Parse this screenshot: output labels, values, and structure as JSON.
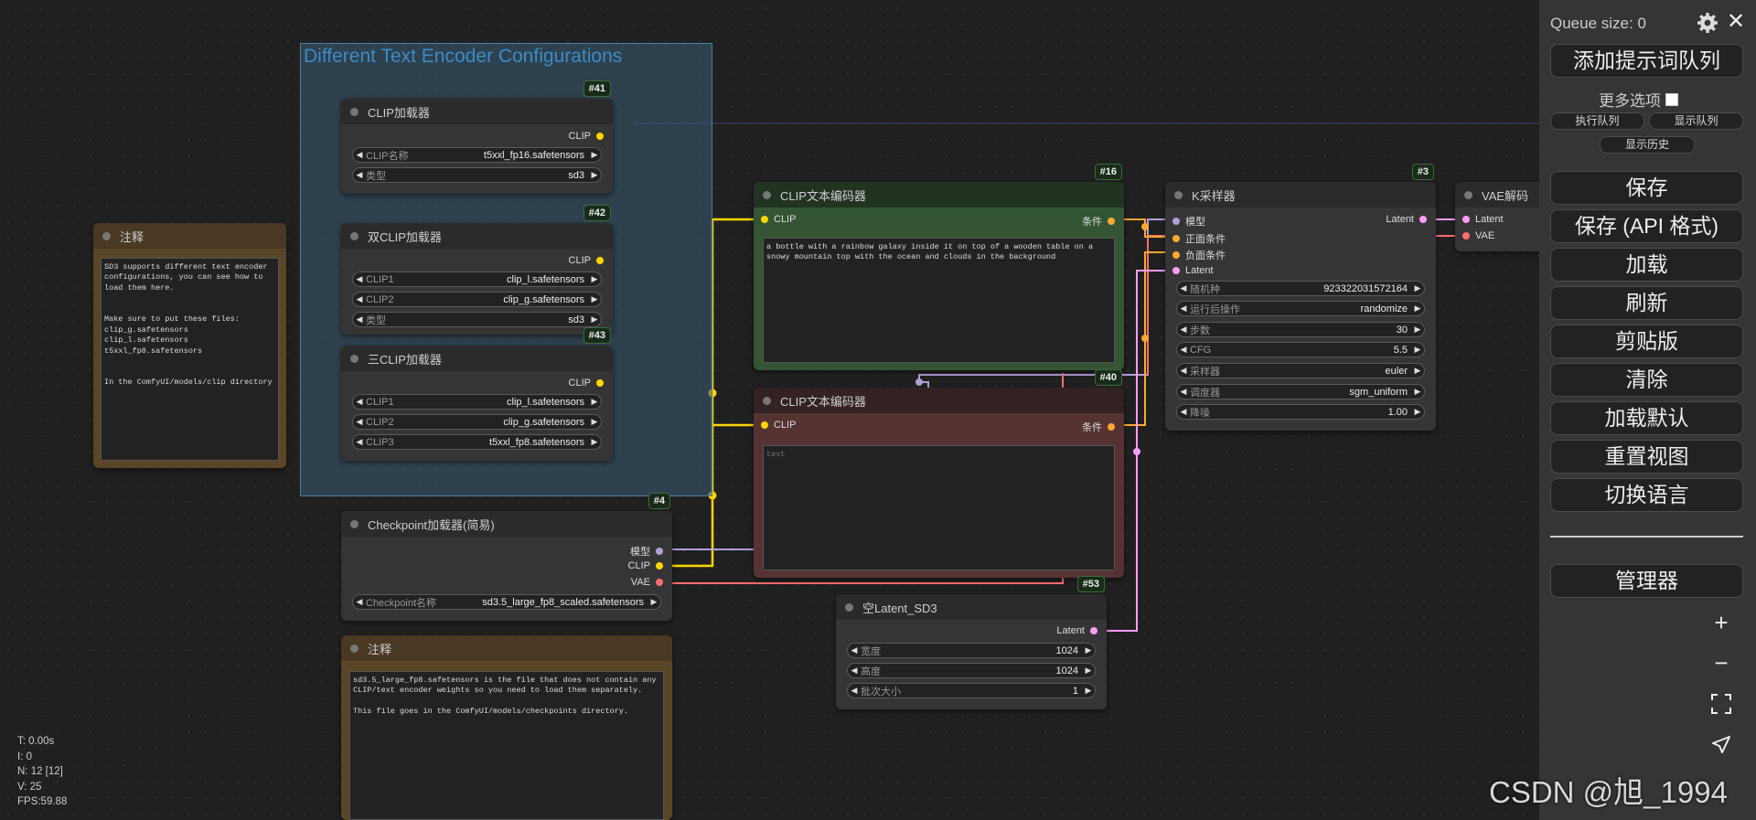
{
  "group": {
    "title": "Different Text Encoder Configurations"
  },
  "nodes": {
    "clip_loader": {
      "id": "#41",
      "title": "CLIP加载器",
      "out": "CLIP",
      "widgets": [
        {
          "label": "CLIP名称",
          "value": "t5xxl_fp16.safetensors"
        },
        {
          "label": "类型",
          "value": "sd3"
        }
      ]
    },
    "dual_clip": {
      "id": "#42",
      "title": "双CLIP加载器",
      "out": "CLIP",
      "widgets": [
        {
          "label": "CLIP1",
          "value": "clip_l.safetensors"
        },
        {
          "label": "CLIP2",
          "value": "clip_g.safetensors"
        },
        {
          "label": "类型",
          "value": "sd3"
        }
      ]
    },
    "triple_clip": {
      "id": "#43",
      "title": "三CLIP加载器",
      "out": "CLIP",
      "widgets": [
        {
          "label": "CLIP1",
          "value": "clip_l.safetensors"
        },
        {
          "label": "CLIP2",
          "value": "clip_g.safetensors"
        },
        {
          "label": "CLIP3",
          "value": "t5xxl_fp8.safetensors"
        }
      ]
    },
    "note1": {
      "title": "注释",
      "text": "SD3 supports different text encoder configurations, you can see how to load them here.\n\n\nMake sure to put these files:\nclip_g.safetensors\nclip_l.safetensors\nt5xxl_fp8.safetensors\n\n\nIn the ComfyUI/models/clip directory"
    },
    "checkpoint": {
      "id": "#4",
      "title": "Checkpoint加载器(简易)",
      "outs": [
        "模型",
        "CLIP",
        "VAE"
      ],
      "widget": {
        "label": "Checkpoint名称",
        "value": "sd3.5_large_fp8_scaled.safetensors"
      }
    },
    "note2": {
      "title": "注释",
      "text": "sd3.5_large_fp8.safetensors is the file that does not contain any CLIP/text encoder weights so you need to load them separately.\n\nThis file goes in the ComfyUI/models/checkpoints directory."
    },
    "pos_encoder": {
      "id": "#16",
      "title": "CLIP文本编码器",
      "in": "CLIP",
      "out": "条件",
      "text": "a bottle with a rainbow galaxy inside it on top of a wooden table on a snowy mountain top with the ocean and clouds in the background"
    },
    "neg_encoder": {
      "id": "#40",
      "title": "CLIP文本编码器",
      "in": "CLIP",
      "out": "条件",
      "placeholder": "text"
    },
    "latent": {
      "id": "#53",
      "title": "空Latent_SD3",
      "out": "Latent",
      "widgets": [
        {
          "label": "宽度",
          "value": "1024"
        },
        {
          "label": "高度",
          "value": "1024"
        },
        {
          "label": "批次大小",
          "value": "1"
        }
      ]
    },
    "ksampler": {
      "id": "#3",
      "title": "K采样器",
      "ins": [
        "模型",
        "正面条件",
        "负面条件",
        "Latent"
      ],
      "out": "Latent",
      "widgets": [
        {
          "label": "随机种",
          "value": "923322031572164"
        },
        {
          "label": "运行后操作",
          "value": "randomize"
        },
        {
          "label": "步数",
          "value": "30"
        },
        {
          "label": "CFG",
          "value": "5.5"
        },
        {
          "label": "采样器",
          "value": "euler"
        },
        {
          "label": "调度器",
          "value": "sgm_uniform"
        },
        {
          "label": "降噪",
          "value": "1.00"
        }
      ]
    },
    "vae_decode": {
      "title": "VAE解码",
      "ins": [
        "Latent",
        "VAE"
      ]
    }
  },
  "stats": {
    "t": "T: 0.00s",
    "i": "I: 0",
    "n": "N: 12 [12]",
    "v": "V: 25",
    "fps": "FPS:59.88"
  },
  "menu": {
    "queue_size": "Queue size: 0",
    "queue_prompt": "添加提示词队列",
    "more_options": "更多选项",
    "view_queue": "执行队列",
    "show_queue": "显示队列",
    "view_history": "显示历史",
    "save": "保存",
    "save_api": "保存 (API 格式)",
    "load": "加载",
    "refresh": "刷新",
    "clipspace": "剪贴版",
    "clear": "清除",
    "load_default": "加载默认",
    "reset_view": "重置视图",
    "switch_locale": "切换语言",
    "manager": "管理器"
  },
  "watermark": "CSDN @旭_1994",
  "colors": {
    "clip": "#ffd500",
    "model": "#b39ddb",
    "vae": "#ff6e6e",
    "latent": "#ff9cf9",
    "conditioning": "#ffa931"
  }
}
